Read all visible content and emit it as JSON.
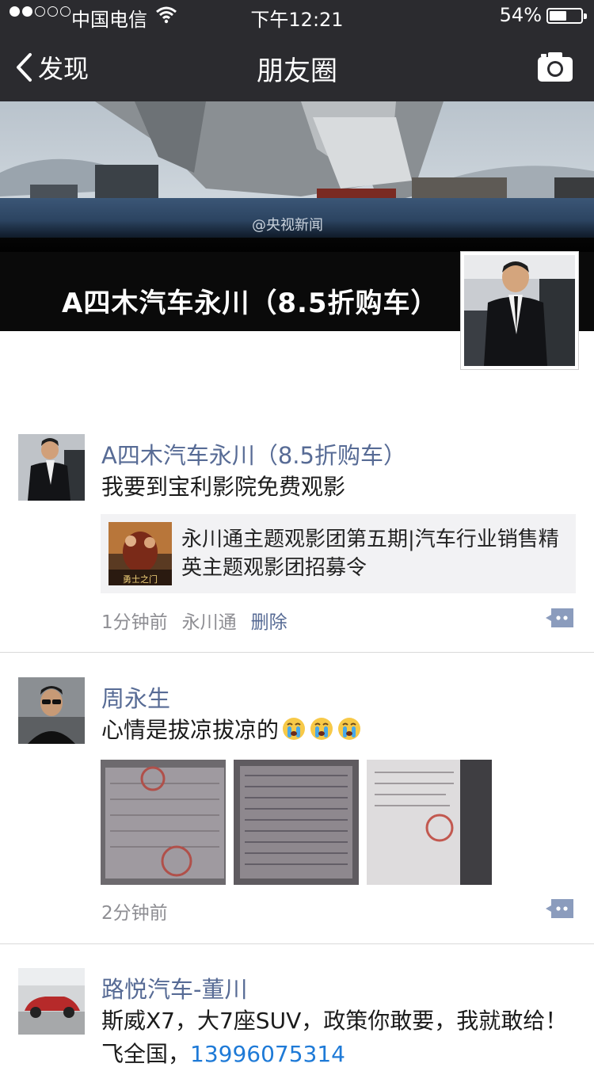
{
  "status_bar": {
    "carrier": "中国电信",
    "time": "下午12:21",
    "battery_percent": "54%",
    "battery_level": 0.54
  },
  "nav": {
    "back_label": "发现",
    "title": "朋友圈"
  },
  "cover": {
    "watermark": "@央视新闻",
    "display_name": "A四木汽车永川（8.5折购车）"
  },
  "posts": [
    {
      "author": "A四木汽车永川（8.5折购车）",
      "text": "我要到宝利影院免费观影",
      "link_title": "永川通主题观影团第五期|汽车行业销售精英主题观影团招募令",
      "link_thumb_text": "勇士之门",
      "time": "1分钟前",
      "source": "永川通",
      "delete_label": "删除"
    },
    {
      "author": "周永生",
      "text": "心情是拔凉拔凉的",
      "emoji": [
        "crying-face",
        "crying-face",
        "crying-face"
      ],
      "time": "2分钟前"
    },
    {
      "author": "路悦汽车-董川",
      "text": "斯威X7，大7座SUV，政策你敢要，我就敢给！飞全国，",
      "phone": "13996075314"
    }
  ],
  "colors": {
    "link_name": "#576b95",
    "nav_bg": "#2b2b2f",
    "phone": "#1e7ad7"
  }
}
